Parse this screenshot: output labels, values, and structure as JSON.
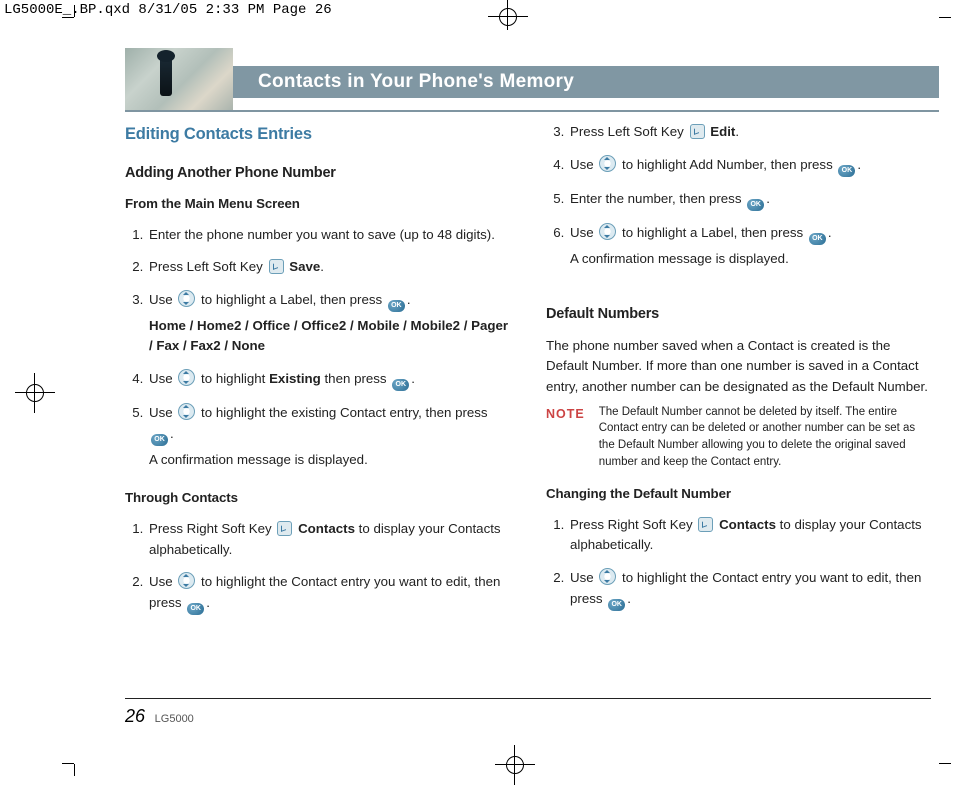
{
  "print_slug": "LG5000E_.BP.qxd  8/31/05  2:33 PM  Page 26",
  "header_title": "Contacts in Your Phone's Memory",
  "section_title": "Editing Contacts Entries",
  "left": {
    "sub1": "Adding Another Phone Number",
    "sub2a": "From the Main Menu Screen",
    "stepsA": {
      "1": "Enter the phone number you want to save (up to 48 digits).",
      "2a": "Press Left Soft Key ",
      "2b": "Save",
      "3a": "Use ",
      "3b": " to highlight a Label, then press ",
      "3labels": "Home / Home2 / Office / Office2 / Mobile / Mobile2 / Pager / Fax / Fax2 / None",
      "4a": "Use ",
      "4b": " to highlight ",
      "4c": "Existing",
      "4d": " then press ",
      "5a": "Use ",
      "5b": " to highlight the existing Contact entry, then press ",
      "5confirm": "A confirmation message is displayed."
    },
    "sub2b": "Through Contacts",
    "stepsB": {
      "1a": "Press Right Soft Key ",
      "1b": "Contacts",
      "1c": " to display your Contacts alphabetically.",
      "2a": "Use ",
      "2b": " to highlight the Contact entry you want to edit, then press "
    }
  },
  "right": {
    "stepsB_cont": {
      "3a": "Press Left Soft Key ",
      "3b": "Edit",
      "4a": "Use ",
      "4b": " to highlight Add Number, then press ",
      "5": "Enter the number, then press ",
      "6a": "Use ",
      "6b": " to highlight a Label, then press ",
      "6confirm": "A confirmation message is displayed."
    },
    "default_heading": "Default Numbers",
    "default_para": "The phone number saved when a Contact is created is the Default Number. If more than one number is saved in a Contact entry, another number can be designated as the Default Number.",
    "note_label": "NOTE",
    "note_text": "The Default Number cannot be deleted by itself. The entire Contact entry can be deleted or another number can be set as the Default Number allowing you to delete the original saved number and keep the Contact entry.",
    "change_heading": "Changing the Default Number",
    "stepsC": {
      "1a": "Press Right Soft Key ",
      "1b": "Contacts",
      "1c": " to display your Contacts alphabetically.",
      "2a": "Use ",
      "2b": " to highlight the Contact entry you want to edit, then press "
    }
  },
  "footer": {
    "page_num": "26",
    "model": "LG5000"
  },
  "ok_glyph": "OK"
}
